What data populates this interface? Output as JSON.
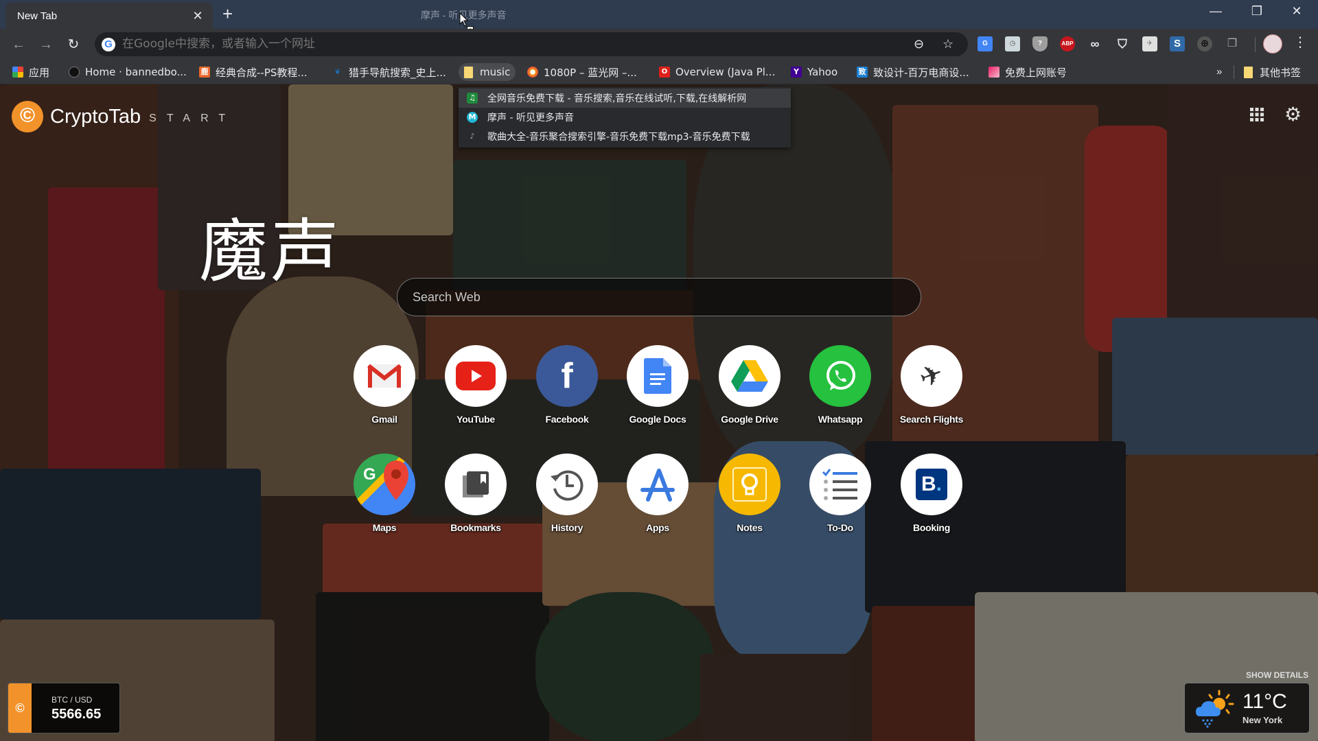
{
  "browser": {
    "tab": {
      "title": "New Tab",
      "close_glyph": "✕"
    },
    "new_tab_glyph": "+",
    "drag_ghost_text": "摩声 - 听见更多声音",
    "window_controls": {
      "minimize": "—",
      "restore": "❐",
      "close": "✕"
    },
    "omnibox": {
      "placeholder": "在Google中搜索，或者输入一个网址",
      "value": ""
    },
    "extensions": [
      "google-translate",
      "clock",
      "shield-question",
      "adblock-plus",
      "link-chain",
      "bookmark",
      "bird-extension",
      "s-extension",
      "globe",
      "copy-pages"
    ],
    "bookmarks": [
      {
        "label": "应用",
        "icon": "apps-grid-icon"
      },
      {
        "label": "Home · bannedbo...",
        "icon": "github-icon"
      },
      {
        "label": "经典合成--PS教程...",
        "icon": "ps-tutorial-icon"
      },
      {
        "label": "猎手导航搜索_史上...",
        "icon": "hunter-icon"
      },
      {
        "label": "music",
        "icon": "folder-icon",
        "active": true
      },
      {
        "label": "1080P – 蓝光网 –...",
        "icon": "bluray-icon"
      },
      {
        "label": "Overview (Java Pl...",
        "icon": "oracle-icon"
      },
      {
        "label": "Yahoo",
        "icon": "yahoo-icon"
      },
      {
        "label": "致设计-百万电商设...",
        "icon": "zhi-design-icon"
      },
      {
        "label": "免费上网账号",
        "icon": "free-account-icon"
      }
    ],
    "bookmarks_overflow": "»",
    "other_bookmarks": "其他书签",
    "music_folder_menu": [
      {
        "label": "全网音乐免费下载 - 音乐搜索,音乐在线试听,下载,在线解析网",
        "icon": "music-note-icon"
      },
      {
        "label": "摩声 - 听见更多声音",
        "icon": "m-circle-icon"
      },
      {
        "label": "歌曲大全-音乐聚合搜索引擎-音乐免费下载mp3-音乐免费下载",
        "icon": "music-hearts-icon"
      }
    ]
  },
  "page": {
    "brand": {
      "name": "CryptoTab",
      "suffix": "START"
    },
    "title": "魔声",
    "search": {
      "placeholder": "Search Web"
    },
    "tiles_row1": [
      {
        "label": "Gmail"
      },
      {
        "label": "YouTube"
      },
      {
        "label": "Facebook"
      },
      {
        "label": "Google Docs"
      },
      {
        "label": "Google Drive"
      },
      {
        "label": "Whatsapp"
      },
      {
        "label": "Search Flights"
      }
    ],
    "tiles_row2": [
      {
        "label": "Maps"
      },
      {
        "label": "Bookmarks"
      },
      {
        "label": "History"
      },
      {
        "label": "Apps"
      },
      {
        "label": "Notes"
      },
      {
        "label": "To-Do"
      },
      {
        "label": "Booking"
      }
    ],
    "btc": {
      "pair": "BTC / USD",
      "price": "5566.65"
    },
    "weather": {
      "show_details": "SHOW DETAILS",
      "temperature": "11°C",
      "city": "New York",
      "condition": "sun-cloud-rain"
    },
    "colors": {
      "cryptotab_orange": "#f2922a",
      "facebook_blue": "#3b5998",
      "whatsapp_green": "#25c13f",
      "notes_yellow": "#f6b800",
      "booking_navy": "#003580"
    }
  }
}
